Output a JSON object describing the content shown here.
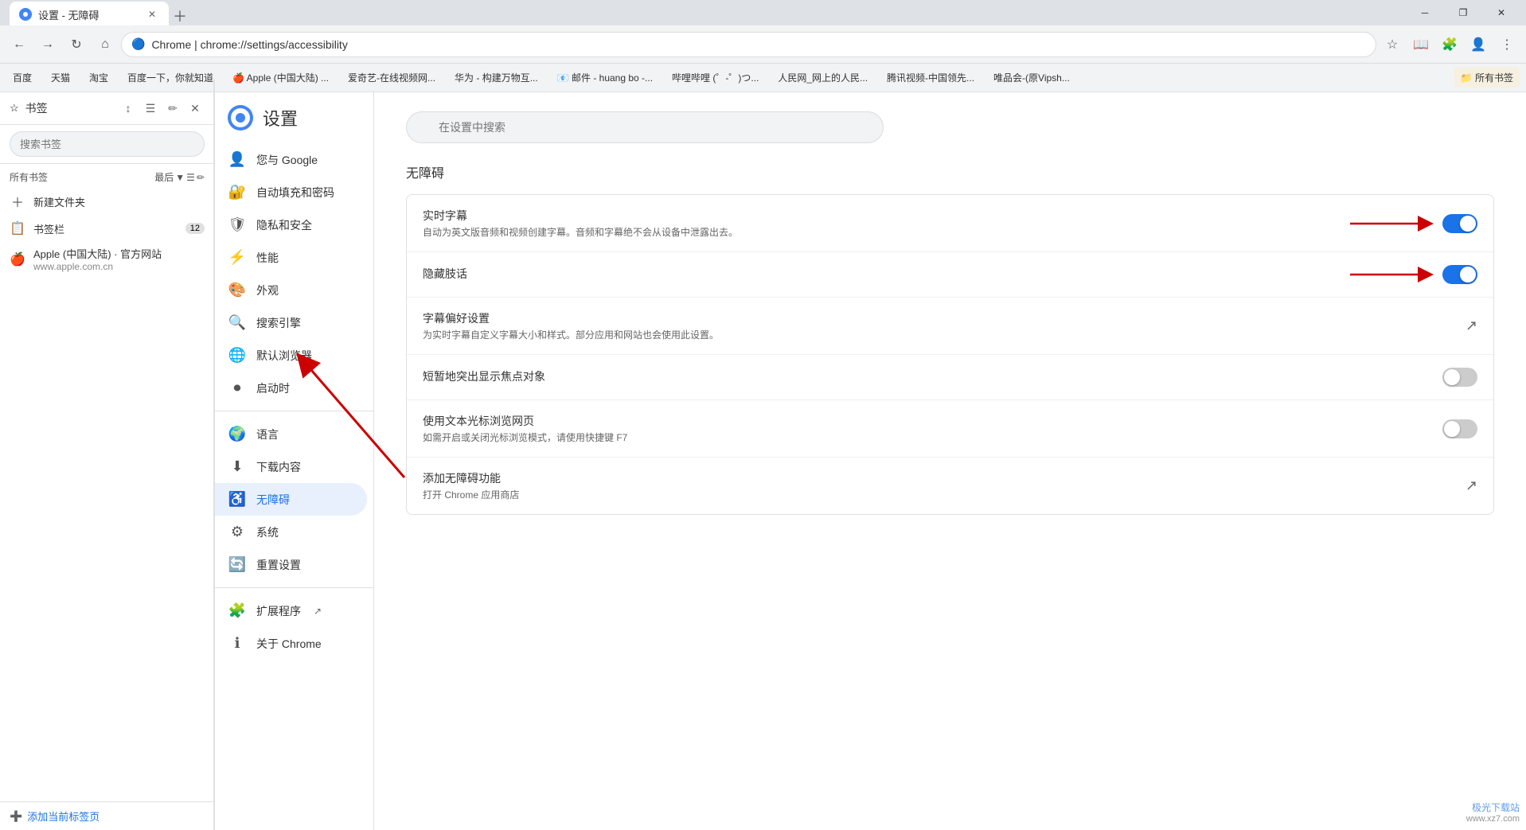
{
  "window": {
    "title": "设置 - 无障碍",
    "tab_label": "设置 - 无障碍",
    "close_btn": "✕",
    "minimize_btn": "─",
    "maximize_btn": "□",
    "restore_btn": "❐"
  },
  "nav": {
    "back": "←",
    "forward": "→",
    "refresh": "↻",
    "home": "⌂",
    "url": "Chrome | chrome://settings/accessibility",
    "url_icon": "🔵"
  },
  "bookmarks_bar": {
    "items": [
      {
        "label": "百度"
      },
      {
        "label": "天猫"
      },
      {
        "label": "淘宝"
      },
      {
        "label": "百度一下，你就知道"
      },
      {
        "label": "Apple (中国大陆) ..."
      },
      {
        "label": "爱奇艺-在线视频网..."
      },
      {
        "label": "华为 - 构建万物互..."
      },
      {
        "label": "邮件 - huang bo -..."
      },
      {
        "label": "哔哩哔哩 (゜-゜)つ..."
      },
      {
        "label": "人民网_网上的人民..."
      },
      {
        "label": "腾讯视频-中国领先..."
      },
      {
        "label": "唯品会-(原Vipsh..."
      },
      {
        "label": "所有书签"
      }
    ]
  },
  "sidebar": {
    "title": "书签",
    "search_placeholder": "搜索书签",
    "section_label": "所有书签",
    "sort_label": "最后",
    "items": [
      {
        "icon": "📁",
        "label": "+ 新建文件夹"
      },
      {
        "icon": "📋",
        "label": "书签栏",
        "count": "12"
      },
      {
        "icon": "🍎",
        "label": "Apple (中国大陆) · 官方网站",
        "sub": "www.apple.com.cn"
      }
    ],
    "add_btn": "添加当前标签页"
  },
  "settings": {
    "title": "设置",
    "search_placeholder": "在设置中搜索",
    "nav_items": [
      {
        "icon": "👤",
        "label": "您与 Google",
        "active": false
      },
      {
        "icon": "🔐",
        "label": "自动填充和密码",
        "active": false
      },
      {
        "icon": "🛡",
        "label": "隐私和安全",
        "active": false
      },
      {
        "icon": "⚡",
        "label": "性能",
        "active": false
      },
      {
        "icon": "🎨",
        "label": "外观",
        "active": false
      },
      {
        "icon": "🔍",
        "label": "搜索引擎",
        "active": false
      },
      {
        "icon": "🌐",
        "label": "默认浏览器",
        "active": false
      },
      {
        "icon": "⏺",
        "label": "启动时",
        "active": false
      },
      {
        "icon": "🌍",
        "label": "语言",
        "active": false
      },
      {
        "icon": "⬇",
        "label": "下载内容",
        "active": false
      },
      {
        "icon": "♿",
        "label": "无障碍",
        "active": true
      },
      {
        "icon": "⚙",
        "label": "系统",
        "active": false
      },
      {
        "icon": "🔄",
        "label": "重置设置",
        "active": false
      },
      {
        "icon": "🧩",
        "label": "扩展程序",
        "active": false,
        "ext": true
      },
      {
        "icon": "ℹ",
        "label": "关于 Chrome",
        "active": false
      }
    ],
    "section_title": "无障碍",
    "rows": [
      {
        "id": "live_caption",
        "title": "实时字幕",
        "desc": "自动为英文版音频和视频创建字幕。音频和字幕绝不会从设备中泄露出去。",
        "type": "toggle",
        "state": "on"
      },
      {
        "id": "hidden_speech",
        "title": "隐藏肢话",
        "desc": "",
        "type": "toggle",
        "state": "on"
      },
      {
        "id": "caption_prefs",
        "title": "字幕偏好设置",
        "desc": "为实时字幕自定义字幕大小和样式。部分应用和网站也会使用此设置。",
        "type": "external",
        "state": ""
      },
      {
        "id": "focus_highlight",
        "title": "短暂地突出显示焦点对象",
        "desc": "",
        "type": "toggle",
        "state": "off"
      },
      {
        "id": "text_cursor",
        "title": "使用文本光标浏览网页",
        "desc": "如需开启或关闭光标浏览模式，请使用快捷键 F7",
        "type": "toggle",
        "state": "off"
      },
      {
        "id": "add_accessibility",
        "title": "添加无障碍功能",
        "desc": "打开 Chrome 应用商店",
        "type": "external",
        "state": ""
      }
    ]
  },
  "watermark": "极光下载站\nwww.xz7.com"
}
